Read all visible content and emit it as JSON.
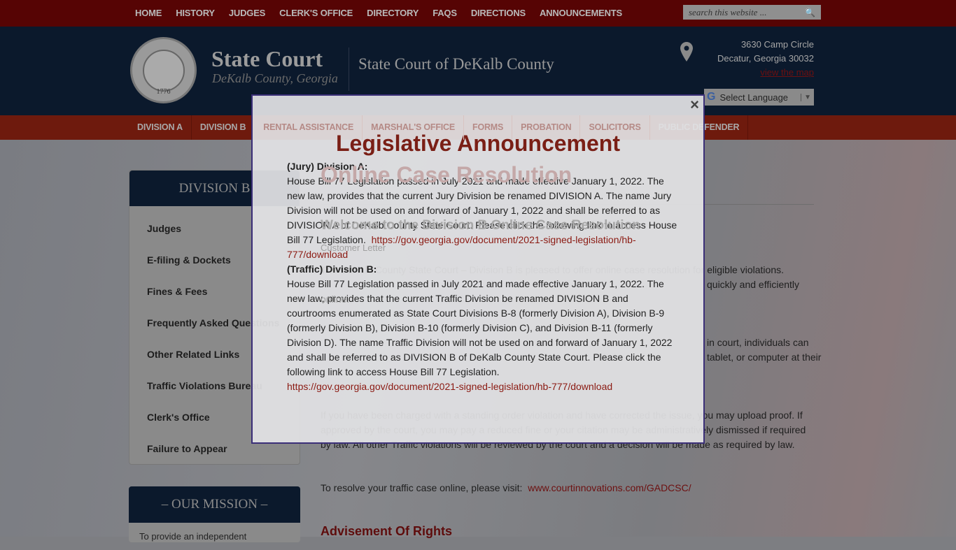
{
  "topnav": {
    "items": [
      "HOME",
      "HISTORY",
      "JUDGES",
      "CLERK'S OFFICE",
      "DIRECTORY",
      "FAQS",
      "DIRECTIONS",
      "ANNOUNCEMENTS"
    ],
    "search_placeholder": "search this website ..."
  },
  "header": {
    "brand_title": "State Court",
    "brand_subtitle": "DeKalb County, Georgia",
    "site_name": "State Court of DeKalb County",
    "seal_year": "1776",
    "seal_text": "STATE OF GEORGIA",
    "address_line1": "3630 Camp Circle",
    "address_line2": "Decatur, Georgia 30032",
    "map_link": "view the map",
    "language": "Select Language"
  },
  "mainnav": {
    "items": [
      "DIVISION A",
      "DIVISION B",
      "RENTAL ASSISTANCE",
      "MARSHAL'S OFFICE",
      "FORMS",
      "PROBATION",
      "SOLICITORS",
      "PUBLIC DEFENDER"
    ]
  },
  "sidebar": {
    "title": "DIVISION B",
    "items": [
      "Judges",
      "E-filing & Dockets",
      "Fines & Fees",
      "Frequently Asked Questions",
      "Other Related Links",
      "Traffic Violations Bureau",
      "Clerk's Office",
      "Failure to Appear"
    ]
  },
  "mission": {
    "title": "– OUR MISSION –",
    "text": "To provide an independent"
  },
  "main": {
    "title": "Online Case Resolution",
    "welcome": "Welcome to the Division B Online Case Resolution",
    "customer_letter": "Customer Letter",
    "p1_line1": "The DeKalb County State Court – Division B is pleased to offer online case resolution for eligible violations.",
    "p1_line2": "quickly and efficiently",
    "p1_line3": "online.",
    "p2_line1": "in court, individuals can",
    "p2_line2": "tablet, or computer at their",
    "p3_line1": "If you have been charged with a standing order violation and have corrected the issue, you may upload proof. If",
    "p3_line2": "approved by the court, you may pay a reduced fine or your citation may be administratively dismissed if required",
    "p3_line3": "by law. All other Traffic violations will be reviewed by the court and a decision will be made as required by law.",
    "resolve_text": "To resolve your traffic case online, please visit:",
    "resolve_link": "www.courtinnovations.com/GADCSC/",
    "advisement": "Advisement Of Rights"
  },
  "modal": {
    "close": "×",
    "title": "Legislative Announcement",
    "a_heading": "(Jury) Division A:",
    "a_text": "House Bill 77 Legislation passed in July 2021 and made effective January 1, 2022.  The new law, provides that the current Jury Division be renamed DIVISION A. The name Jury Division will not be used on and forward of January 1, 2022 and shall be referred to as DIVISION A of DeKalb County State Court.  Please click the following link to access House Bill 77 Legislation.",
    "a_link": "https://gov.georgia.gov/document/2021-signed-legislation/hb-777/download",
    "b_heading": "(Traffic) Division B:",
    "b_text": "House Bill 77 Legislation passed in July 2021 and made effective January 1, 2022.  The new law, provides that the current Traffic Division be renamed DIVISION B and courtrooms enumerated as State Court Divisions B-8 (formerly Division A), Division B-9 (formerly Division B), Division B-10 (formerly Division C), and Division B-11 (formerly Division D).  The name Traffic Division will not be used on and forward of January 1, 2022 and shall be referred to as DIVISION B of DeKalb County State Court.  Please click the following link to access House Bill 77 Legislation.",
    "b_link": "https://gov.georgia.gov/document/2021-signed-legislation/hb-777/download"
  },
  "colors": {
    "accent_red": "#7a1f16",
    "navy": "#0b192c",
    "modal_border": "#3b2f78"
  }
}
